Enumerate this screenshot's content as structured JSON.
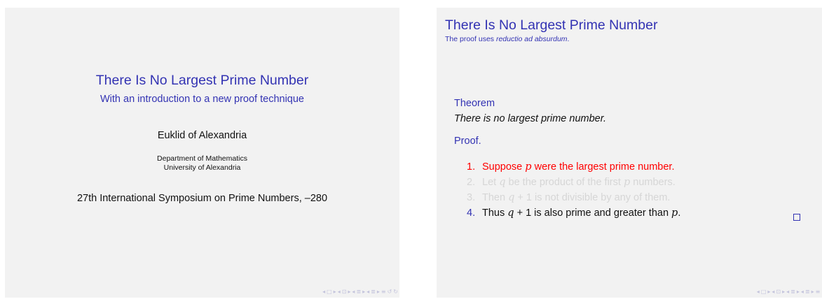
{
  "title_slide": {
    "title": "There Is No Largest Prime Number",
    "subtitle": "With an introduction to a new proof technique",
    "author": "Euklid of Alexandria",
    "institute_line1": "Department of Mathematics",
    "institute_line2": "University of Alexandria",
    "date": "27th International Symposium on Prime Numbers, –280"
  },
  "frame_slide": {
    "title": "There Is No Largest Prime Number",
    "subtitle_prefix": "The proof uses ",
    "subtitle_emph": "reductio ad absurdum",
    "subtitle_suffix": ".",
    "theorem_heading": "Theorem",
    "theorem_text": "There is no largest prime number.",
    "proof_heading": "Proof.",
    "steps": [
      {
        "num": "1.",
        "pre": "Suppose ",
        "math": "p",
        "post": " were the largest prime number.",
        "state": "alert"
      },
      {
        "num": "2.",
        "pre": "Let ",
        "math": "q",
        "post": " be the product of the first ",
        "math2": "p",
        "post2": " numbers.",
        "state": "dim"
      },
      {
        "num": "3.",
        "pre": "Then ",
        "math": "q",
        "post": " + 1 is not divisible by any of them.",
        "state": "dim"
      },
      {
        "num": "4.",
        "pre": "Thus ",
        "math": "q",
        "post": " + 1 is also prime and greater than ",
        "math2": "p",
        "post2": ".",
        "state": "normal"
      }
    ]
  },
  "nav_symbols": {
    "left_arrow": "◂",
    "right_arrow": "▸",
    "frame_icon": "□",
    "subsection_icon": "⊡",
    "section_icon": "≣",
    "align_icon": "≡",
    "search_icon": "↺",
    "search_icon2": "↻"
  }
}
